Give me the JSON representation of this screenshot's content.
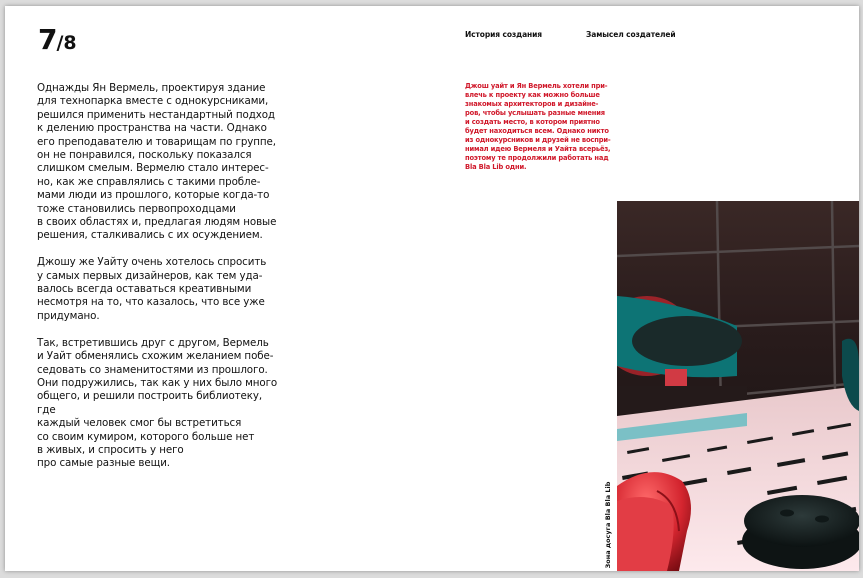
{
  "page_counter": {
    "current": "7",
    "total": "/8"
  },
  "nav": {
    "item1": "История создания",
    "item2": "Замысел создателей"
  },
  "body": {
    "paragraphs": [
      "Однажды Ян Вермель, проектируя здание\nдля технопарка вместе с однокурсниками,\nрешился применить нестандартный подход\nк делению пространства на части. Однако\nего преподавателю и товарищам по группе,\nон не понравился, поскольку показался\nслишком смелым. Вермелю стало интерес-\nно, как же справлялись с такими пробле-\nмами люди из прошлого, которые когда-то\nтоже становились первопроходцами\nв своих областях и, предлагая людям новые\nрешения, сталкивались с их осуждением.",
      "Джошу же Уайту очень хотелось спросить\nу самых первых дизайнеров, как тем уда-\nвалось всегда оставаться креативными\nнесмотря на то, что казалось, что все уже\nпридумано.",
      "Так, встретившись друг с другом, Вермель\nи Уайт обменялись схожим желанием побе-\nседовать со знаменитостями из прошлого.\nОни подружились, так как у них было много\nобщего, и решили построить библиотеку, где\nкаждый человек смог бы встретиться\nсо своим кумиром, которого больше нет\nв живых, и спросить у него\nпро самые разные вещи."
    ]
  },
  "quote": "Джош уайт и Ян Вермель хотели при-\nвлечь к проекту как можно больше\nзнакомых архитекторов и дизайне-\nров, чтобы услышать разные мнения\nи создать место, в котором приятно\nбудет находиться всем. Однако никто\nиз однокурсников и друзей не воспри-\nнимал идею Вермеля и Уайта всерьёз,\nпоэтому те продолжили работать над\nBla Bla Lib одни.",
  "photo": {
    "caption": "Зона досуга Bla Bla Lib"
  },
  "colors": {
    "accent": "#d0182a",
    "text": "#111111",
    "page": "#ffffff"
  }
}
